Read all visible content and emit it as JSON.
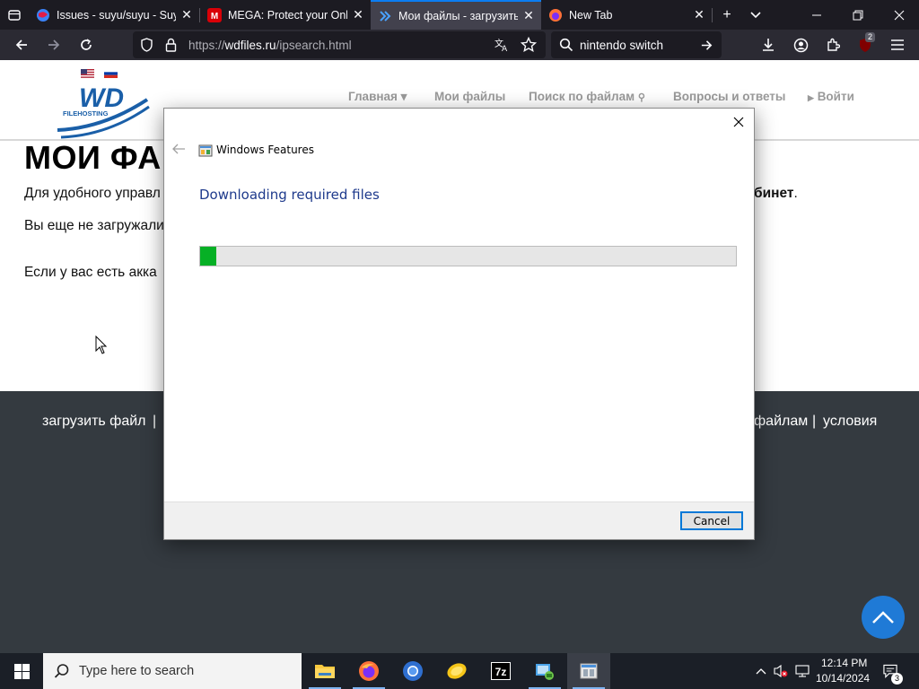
{
  "browser": {
    "tabs": [
      {
        "title": "Issues - suyu/suyu - Suyu",
        "active": false
      },
      {
        "title": "MEGA: Protect your Online",
        "active": false
      },
      {
        "title": "Мои файлы - загрузить",
        "active": true
      },
      {
        "title": "New Tab",
        "active": false
      }
    ],
    "url": {
      "prefix": "https://",
      "host": "wdfiles.ru",
      "path": "/ipsearch.html"
    },
    "search_value": "nintendo switch",
    "extension_badge": "2"
  },
  "site": {
    "logo_text": "WD",
    "logo_sub": "FILEHOSTING",
    "menu": {
      "home": "Главная ▾",
      "files": "Мои файлы",
      "search": "Поиск по файлам",
      "faq": "Вопросы и ответы",
      "login": "Войти"
    },
    "heading": "МОИ ФА",
    "text1": "Для удобного управл",
    "text1_tail": "бинет",
    "text1_end": ".",
    "text2": "Вы еще не загружали",
    "text3": "Если у вас есть акка",
    "footer": {
      "upload": "загрузить файл",
      "sep1": "|",
      "files_search": "файлам",
      "sep2": "|",
      "terms": "условия"
    }
  },
  "dialog": {
    "title": "Windows Features",
    "heading": "Downloading required files",
    "progress": 0.03,
    "cancel_label": "Cancel"
  },
  "taskbar": {
    "search_placeholder": "Type here to search",
    "time": "12:14 PM",
    "date": "10/14/2024",
    "notification_count": "3"
  },
  "colors": {
    "accent": "#0078d7",
    "progress": "#06b025",
    "dialog_heading": "#1e3a8c",
    "footer_bg": "#343a40",
    "scroll_top": "#1f7ad6"
  }
}
